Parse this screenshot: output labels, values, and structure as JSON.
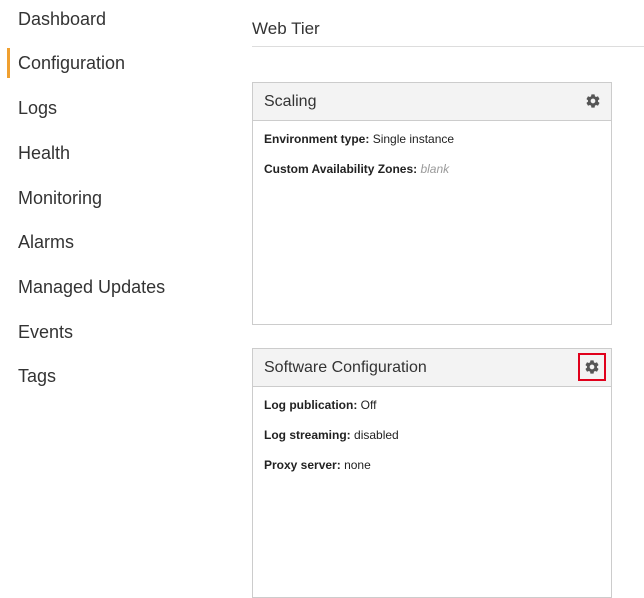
{
  "sidebar": {
    "items": [
      {
        "label": "Dashboard"
      },
      {
        "label": "Configuration",
        "active": true
      },
      {
        "label": "Logs"
      },
      {
        "label": "Health"
      },
      {
        "label": "Monitoring"
      },
      {
        "label": "Alarms"
      },
      {
        "label": "Managed Updates"
      },
      {
        "label": "Events"
      },
      {
        "label": "Tags"
      }
    ],
    "active_color": "#f0a030"
  },
  "header": {
    "title": "Web Tier"
  },
  "panels": {
    "scaling": {
      "title": "Scaling",
      "gear_icon": "gear-icon",
      "fields": [
        {
          "label": "Environment type:",
          "value": "Single instance"
        },
        {
          "label": "Custom Availability Zones:",
          "value": "blank"
        }
      ]
    },
    "software": {
      "title": "Software Configuration",
      "gear_icon": "gear-icon",
      "highlight_color": "#e0001b",
      "fields": [
        {
          "label": "Log publication:",
          "value": "Off"
        },
        {
          "label": "Log streaming:",
          "value": "disabled"
        },
        {
          "label": "Proxy server:",
          "value": "none"
        }
      ]
    }
  }
}
